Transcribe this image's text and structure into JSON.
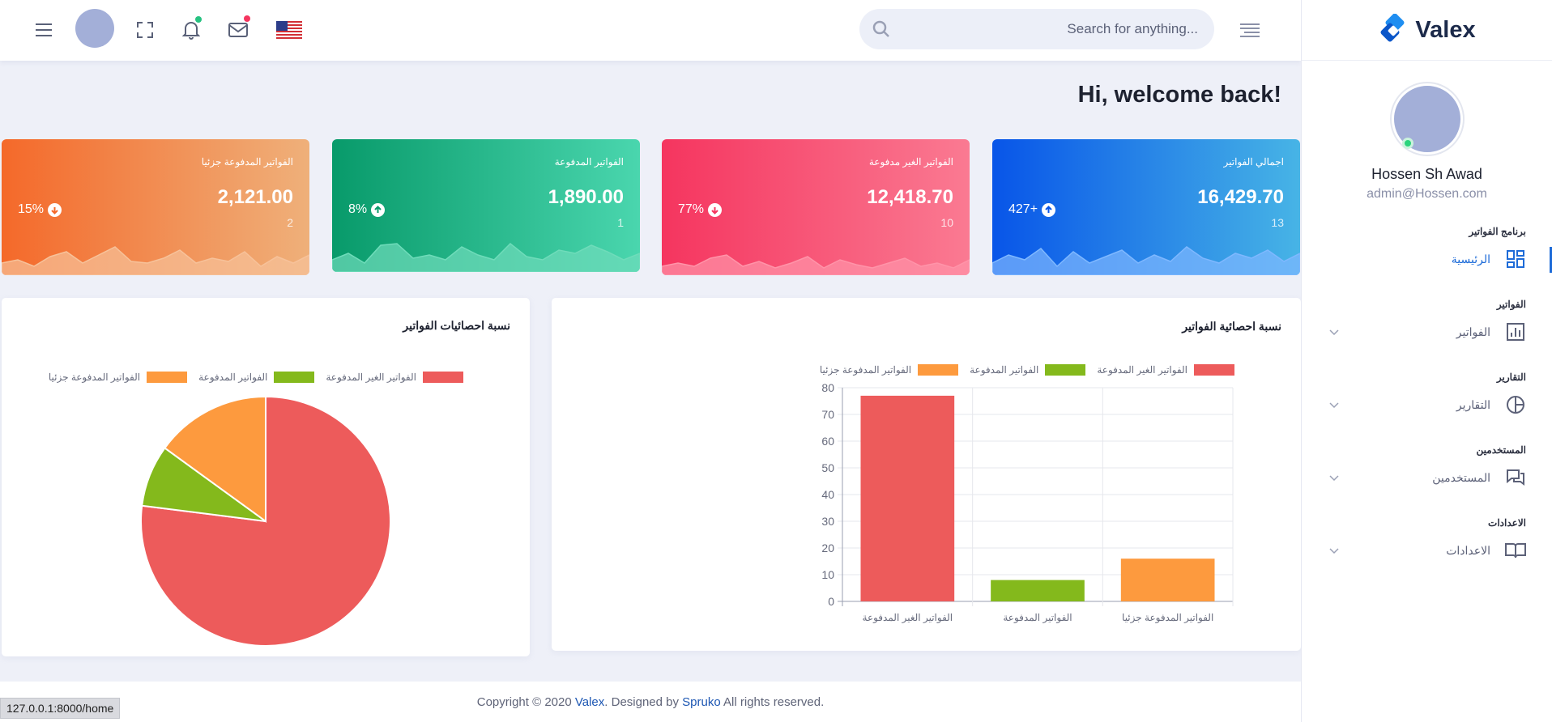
{
  "brand": {
    "name": "Valex"
  },
  "profile": {
    "name": "Hossen Sh Awad",
    "email": "admin@Hossen.com"
  },
  "sidebar": {
    "sections": [
      {
        "category": "برنامج الفواتير",
        "label": "الرئيسية",
        "icon": "dashboard-icon",
        "active": true
      },
      {
        "category": "الفواتير",
        "label": "الفواتير",
        "icon": "bar-chart-icon"
      },
      {
        "category": "التقارير",
        "label": "التقارير",
        "icon": "pie-chart-icon"
      },
      {
        "category": "المستخدمين",
        "label": "المستخدمين",
        "icon": "chat-icon"
      },
      {
        "category": "الاعدادات",
        "label": "الاعدادات",
        "icon": "book-icon"
      }
    ]
  },
  "search": {
    "placeholder": "Search for anything..."
  },
  "header": {
    "welcome": "Hi, welcome back!"
  },
  "cards": [
    {
      "title": "اجمالي الفواتير",
      "value": "16,429.70",
      "count": "13",
      "percent": "427+",
      "trend": "up",
      "gradient": [
        "#0855e8",
        "#47b4e6"
      ],
      "spark": "#7fb8ff"
    },
    {
      "title": "الفواتير الغير مدفوعة",
      "value": "12,418.70",
      "count": "10",
      "percent": "77%",
      "trend": "down",
      "gradient": [
        "#f5355f",
        "#fa7a92"
      ],
      "spark": "#ff94a9"
    },
    {
      "title": "الفواتير المدفوعة",
      "value": "1,890.00",
      "count": "1",
      "percent": "8%",
      "trend": "up",
      "gradient": [
        "#089a6a",
        "#4ad6ae"
      ],
      "spark": "#6fdcba"
    },
    {
      "title": "الفواتير المدفوعة جزئيا",
      "value": "2,121.00",
      "count": "2",
      "percent": "15%",
      "trend": "down",
      "gradient": [
        "#f4692a",
        "#efb07a"
      ],
      "spark": "#f7c29a"
    }
  ],
  "bar_panel": {
    "title": "نسبة احصائية الفواتير"
  },
  "pie_panel": {
    "title": "نسبة احصائيات الفواتير"
  },
  "chart_data": [
    {
      "type": "bar",
      "title": "نسبة احصائية الفواتير",
      "categories": [
        "الفواتير الغير المدفوعة",
        "الفواتير المدفوعة",
        "الفواتير المدفوعة جزئيا"
      ],
      "values": [
        77,
        8,
        16
      ],
      "colors": [
        "#ed5b5b",
        "#84b91c",
        "#fd9a3e"
      ],
      "ylim": [
        0,
        80
      ],
      "yticks": [
        0,
        10,
        20,
        30,
        40,
        50,
        60,
        70,
        80
      ],
      "grid": true,
      "legend_position": "top"
    },
    {
      "type": "pie",
      "title": "نسبة احصائيات الفواتير",
      "categories": [
        "الفواتير الغير المدفوعة",
        "الفواتير المدفوعة",
        "الفواتير المدفوعة جزئيا"
      ],
      "values": [
        77,
        8,
        15
      ],
      "colors": [
        "#ed5b5b",
        "#84b91c",
        "#fd9a3e"
      ],
      "legend_position": "top"
    }
  ],
  "footer": {
    "prefix": "Copyright © 2020 ",
    "brand": "Valex",
    "middle": ". Designed by ",
    "designer": "Spruko",
    "suffix": " All rights reserved."
  },
  "status_url": "127.0.0.1:8000/home"
}
